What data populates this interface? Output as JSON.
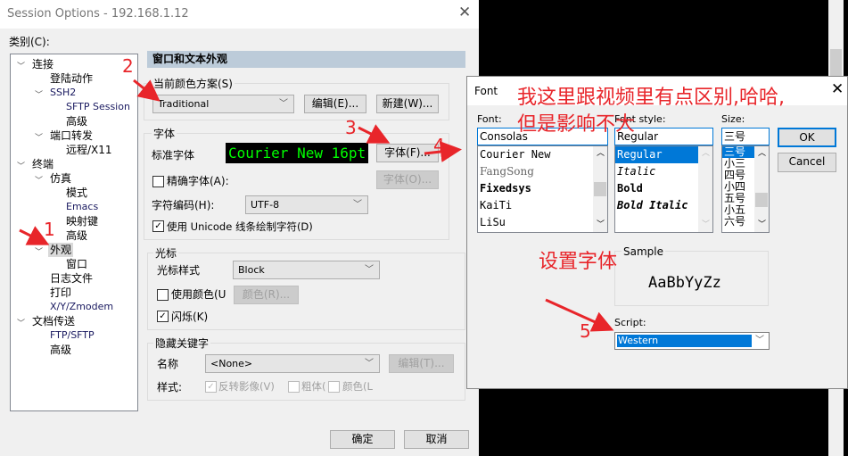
{
  "session_dialog": {
    "title": "Session Options - 192.168.1.12",
    "category_label": "类别(C):",
    "tree": [
      {
        "label": "连接",
        "level": 0,
        "expanded": true
      },
      {
        "label": "登陆动作",
        "level": 1
      },
      {
        "label": "SSH2",
        "level": 1,
        "expanded": true
      },
      {
        "label": "SFTP Session",
        "level": 2
      },
      {
        "label": "高级",
        "level": 2
      },
      {
        "label": "端口转发",
        "level": 1,
        "expanded": true
      },
      {
        "label": "远程/X11",
        "level": 2
      },
      {
        "label": "终端",
        "level": 0,
        "expanded": true
      },
      {
        "label": "仿真",
        "level": 1,
        "expanded": true
      },
      {
        "label": "模式",
        "level": 2
      },
      {
        "label": "Emacs",
        "level": 2
      },
      {
        "label": "映射键",
        "level": 2
      },
      {
        "label": "高级",
        "level": 2
      },
      {
        "label": "外观",
        "level": 1,
        "expanded": true,
        "selected": true
      },
      {
        "label": "窗口",
        "level": 2
      },
      {
        "label": "日志文件",
        "level": 1
      },
      {
        "label": "打印",
        "level": 1
      },
      {
        "label": "X/Y/Zmodem",
        "level": 1
      },
      {
        "label": "文档传送",
        "level": 0,
        "expanded": true
      },
      {
        "label": "FTP/SFTP",
        "level": 1
      },
      {
        "label": "高级",
        "level": 1
      }
    ],
    "panel_title": "窗口和文本外观",
    "color_scheme": {
      "group": "当前颜色方案(S)",
      "value": "Traditional",
      "edit": "编辑(E)...",
      "new": "新建(W)..."
    },
    "font": {
      "group": "字体",
      "standard_label": "标准字体",
      "preview": "Courier New 16pt",
      "font_button": "字体(F)...",
      "font_o_button": "字体(O)...",
      "precise_label": "精确字体(A):",
      "precise_checked": false,
      "encoding_label": "字符编码(H):",
      "encoding_value": "UTF-8",
      "unicode_label": "使用 Unicode 线条绘制字符(D)",
      "unicode_checked": true
    },
    "cursor": {
      "group": "光标",
      "style_label": "光标样式",
      "style_value": "Block",
      "use_color_label": "使用颜色(U",
      "use_color_checked": false,
      "color_button": "颜色(R)...",
      "blink_label": "闪烁(K)",
      "blink_checked": true
    },
    "keywords": {
      "group": "隐藏关键字",
      "name_label": "名称",
      "name_value": "<None>",
      "edit_button": "编辑(T)...",
      "style_label": "样式:",
      "reverse_label": "反转影像(V)",
      "reverse_checked": true,
      "bold_label": "粗体(",
      "bold_checked": false,
      "color_label": "颜色(L)",
      "color_checked": false
    },
    "ok": "确定",
    "cancel": "取消"
  },
  "font_dialog": {
    "title": "Font",
    "font_label": "Font:",
    "font_value": "Consolas",
    "fonts": [
      "Courier New",
      "FangSong",
      "Fixedsys",
      "KaiTi",
      "LiSu"
    ],
    "style_label": "Font style:",
    "style_value": "Regular",
    "styles": [
      "Regular",
      "Italic",
      "Bold",
      "Bold Italic"
    ],
    "size_label": "Size:",
    "size_value": "三号",
    "sizes": [
      "三号",
      "小三",
      "四号",
      "小四",
      "五号",
      "小五",
      "六号"
    ],
    "ok": "OK",
    "cancel": "Cancel",
    "sample_label": "Sample",
    "sample_text": "AaBbYyZz",
    "script_label": "Script:",
    "script_value": "Western"
  },
  "annotations": {
    "note_line1": "我这里跟视频里有点区别,哈哈,",
    "note_line2": "但是影响不大",
    "set_font": "设置字体",
    "steps": [
      "1",
      "2",
      "3",
      "4",
      "5"
    ],
    "color": "#e8252a"
  },
  "colors": {
    "accent": "#0078d7",
    "panel_header": "#bccbd9",
    "preview_text": "#00ff00"
  }
}
